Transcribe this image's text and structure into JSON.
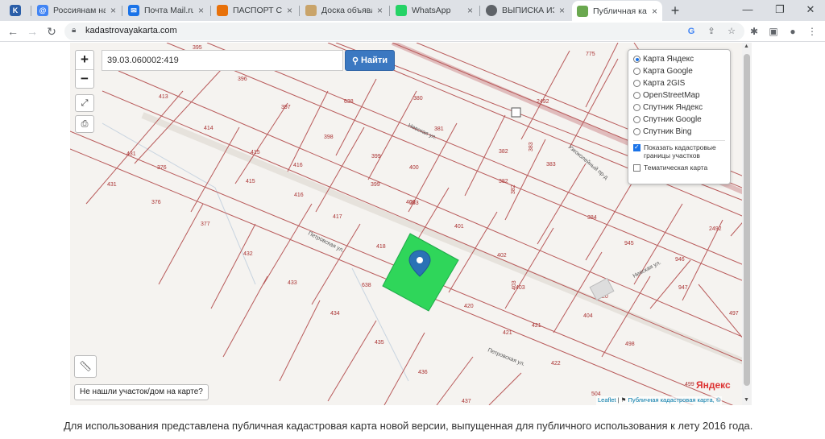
{
  "browser": {
    "tabs": [
      {
        "label": "",
        "favicon": "K",
        "color": "#2a5ea8"
      },
      {
        "label": "Россиянам напо",
        "favicon": "@",
        "color": "#1a73e8"
      },
      {
        "label": "Почта Mail.ru",
        "favicon": "✉",
        "color": "#1a73e8"
      },
      {
        "label": "ПАСПОРТ СОБС",
        "favicon": "●",
        "color": "#e8710a"
      },
      {
        "label": "Доска объявле",
        "favicon": "●",
        "color": "#c9a46a"
      },
      {
        "label": "WhatsApp",
        "favicon": "●",
        "color": "#25d366"
      },
      {
        "label": "ВЫПИСКА ИЗ Е",
        "favicon": "●",
        "color": "#5f6368"
      },
      {
        "label": "Публичная карт",
        "favicon": "●",
        "color": "#6aa84f"
      }
    ],
    "url": "kadastrovayakarta.com"
  },
  "map": {
    "search_value": "39.03.060002:419",
    "search_button": "Найти",
    "layers": [
      {
        "label": "Карта Яндекс",
        "selected": true
      },
      {
        "label": "Карта Google",
        "selected": false
      },
      {
        "label": "Карта 2GIS",
        "selected": false
      },
      {
        "label": "OpenStreetMap",
        "selected": false
      },
      {
        "label": "Спутник Яндекс",
        "selected": false
      },
      {
        "label": "Спутник Google",
        "selected": false
      },
      {
        "label": "Спутник Bing",
        "selected": false
      }
    ],
    "show_cadastral": "Показать кадастровые границы участков",
    "thematic": "Тематическая карта",
    "not_found": "Не нашли участок/дом на карте?",
    "attribution_leaflet": "Leaflet",
    "attribution_rest": "Публичная кадастровая карта, ©",
    "yandex": "Яндекс",
    "parcel_labels": [
      "395",
      "396",
      "413",
      "397",
      "638",
      "380",
      "775",
      "414",
      "398",
      "381",
      "2492",
      "431",
      "415",
      "399",
      "382",
      "416",
      "376",
      "415",
      "400",
      "383",
      "431",
      "376",
      "416",
      "399",
      "383",
      "382",
      "377",
      "417",
      "400",
      "401",
      "384",
      "945",
      "2492",
      "432",
      "418",
      "402",
      "946",
      "433",
      "638",
      "403",
      "947",
      "20",
      "434",
      "420",
      "404",
      "497",
      "421",
      "421",
      "498",
      "435",
      "422",
      "436",
      "504",
      "499",
      "437",
      "403",
      "383",
      "382"
    ],
    "street_labels": [
      "Невская ул.",
      "Узкоколейный пр-д",
      "Петровская ул.",
      "Невская ул.",
      "Петровская ул."
    ],
    "highlight_color": "#2fd65a"
  },
  "caption": "Для использования представлена публичная кадастровая карта новой версии, выпущенная для публичного использования к лету 2016 года."
}
